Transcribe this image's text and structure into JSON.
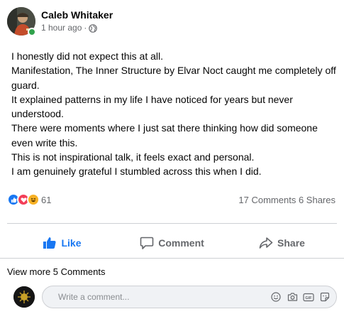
{
  "post": {
    "author": "Caleb Whitaker",
    "timestamp": "1 hour ago",
    "separator": "·",
    "audience_icon": "globe-icon",
    "lines": [
      "I honestly did not expect this at all.",
      "Manifestation, The Inner Structure by Elvar Noct caught me completely off guard.",
      "It explained patterns in my life I have noticed for years but never understood.",
      "There were moments where I just sat there thinking how did someone even write this.",
      "This is not inspirational talk, it feels exact and personal.",
      "I am genuinely grateful I stumbled across this when I did."
    ]
  },
  "stats": {
    "reaction_icons": [
      "like-icon",
      "love-icon",
      "haha-icon"
    ],
    "reaction_count": "61",
    "comments": "17 Comments",
    "shares": "6 Shares"
  },
  "actions": {
    "like": "Like",
    "comment": "Comment",
    "share": "Share"
  },
  "view_more": "View more 5 Comments",
  "composer": {
    "placeholder": "Write a comment..."
  },
  "colors": {
    "accent": "#1877f2",
    "online": "#31a24c",
    "love": "#f33e58",
    "haha": "#f7b125",
    "muted_text": "#65676b"
  }
}
